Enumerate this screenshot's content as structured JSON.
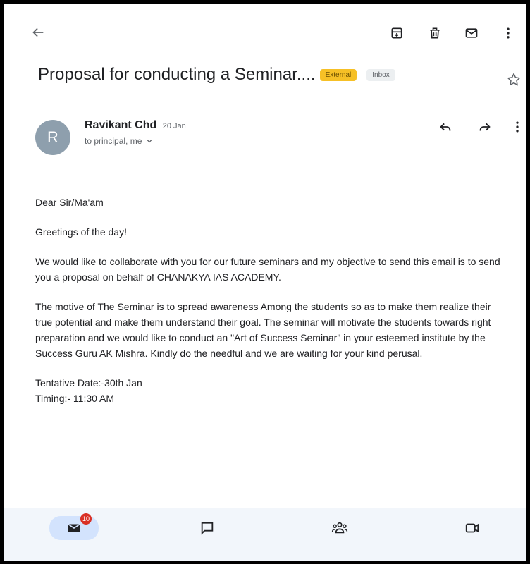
{
  "email": {
    "subject": "Proposal for conducting a Seminar....",
    "labels": {
      "external": "External",
      "inbox": "Inbox"
    },
    "sender": {
      "avatar_letter": "R",
      "name": "Ravikant Chd",
      "date": "20 Jan"
    },
    "recipients": "to principal, me",
    "body": {
      "greeting": "Dear Sir/Ma'am",
      "line1": "Greetings of the day!",
      "para1": "We would like to collaborate with you for our future seminars and my objective to send this email is to send you a proposal on behalf of CHANAKYA IAS ACADEMY.",
      "para2": "The motive of The Seminar is to spread awareness Among the students so as to make them realize their true potential and make them understand their goal. The seminar will motivate the students towards right preparation and we would like to conduct an \"Art of Success Seminar\" in your esteemed institute by the Success Guru AK Mishra. Kindly do the needful and we are waiting for your kind perusal.",
      "date_line": "Tentative Date:-30th Jan",
      "timing_line": "Timing:- 11:30 AM"
    }
  },
  "bottom_nav": {
    "mail_badge": "10"
  },
  "icons": {
    "back": "arrow-left",
    "archive": "archive-box",
    "delete": "trash-can",
    "mark_unread": "envelope",
    "more": "vertical-dots",
    "star": "star-outline",
    "reply": "reply-arrow",
    "forward": "forward-arrow",
    "expand": "chevron-down",
    "mail": "mail",
    "chat": "chat-bubble",
    "spaces": "people-group",
    "meet": "video-camera"
  },
  "colors": {
    "external_chip": "#f6c026",
    "inbox_chip": "#eceff1",
    "avatar": "#8e9fad",
    "badge": "#d93025",
    "nav_bg": "#f2f6fb",
    "nav_active": "#d3e3fd"
  }
}
